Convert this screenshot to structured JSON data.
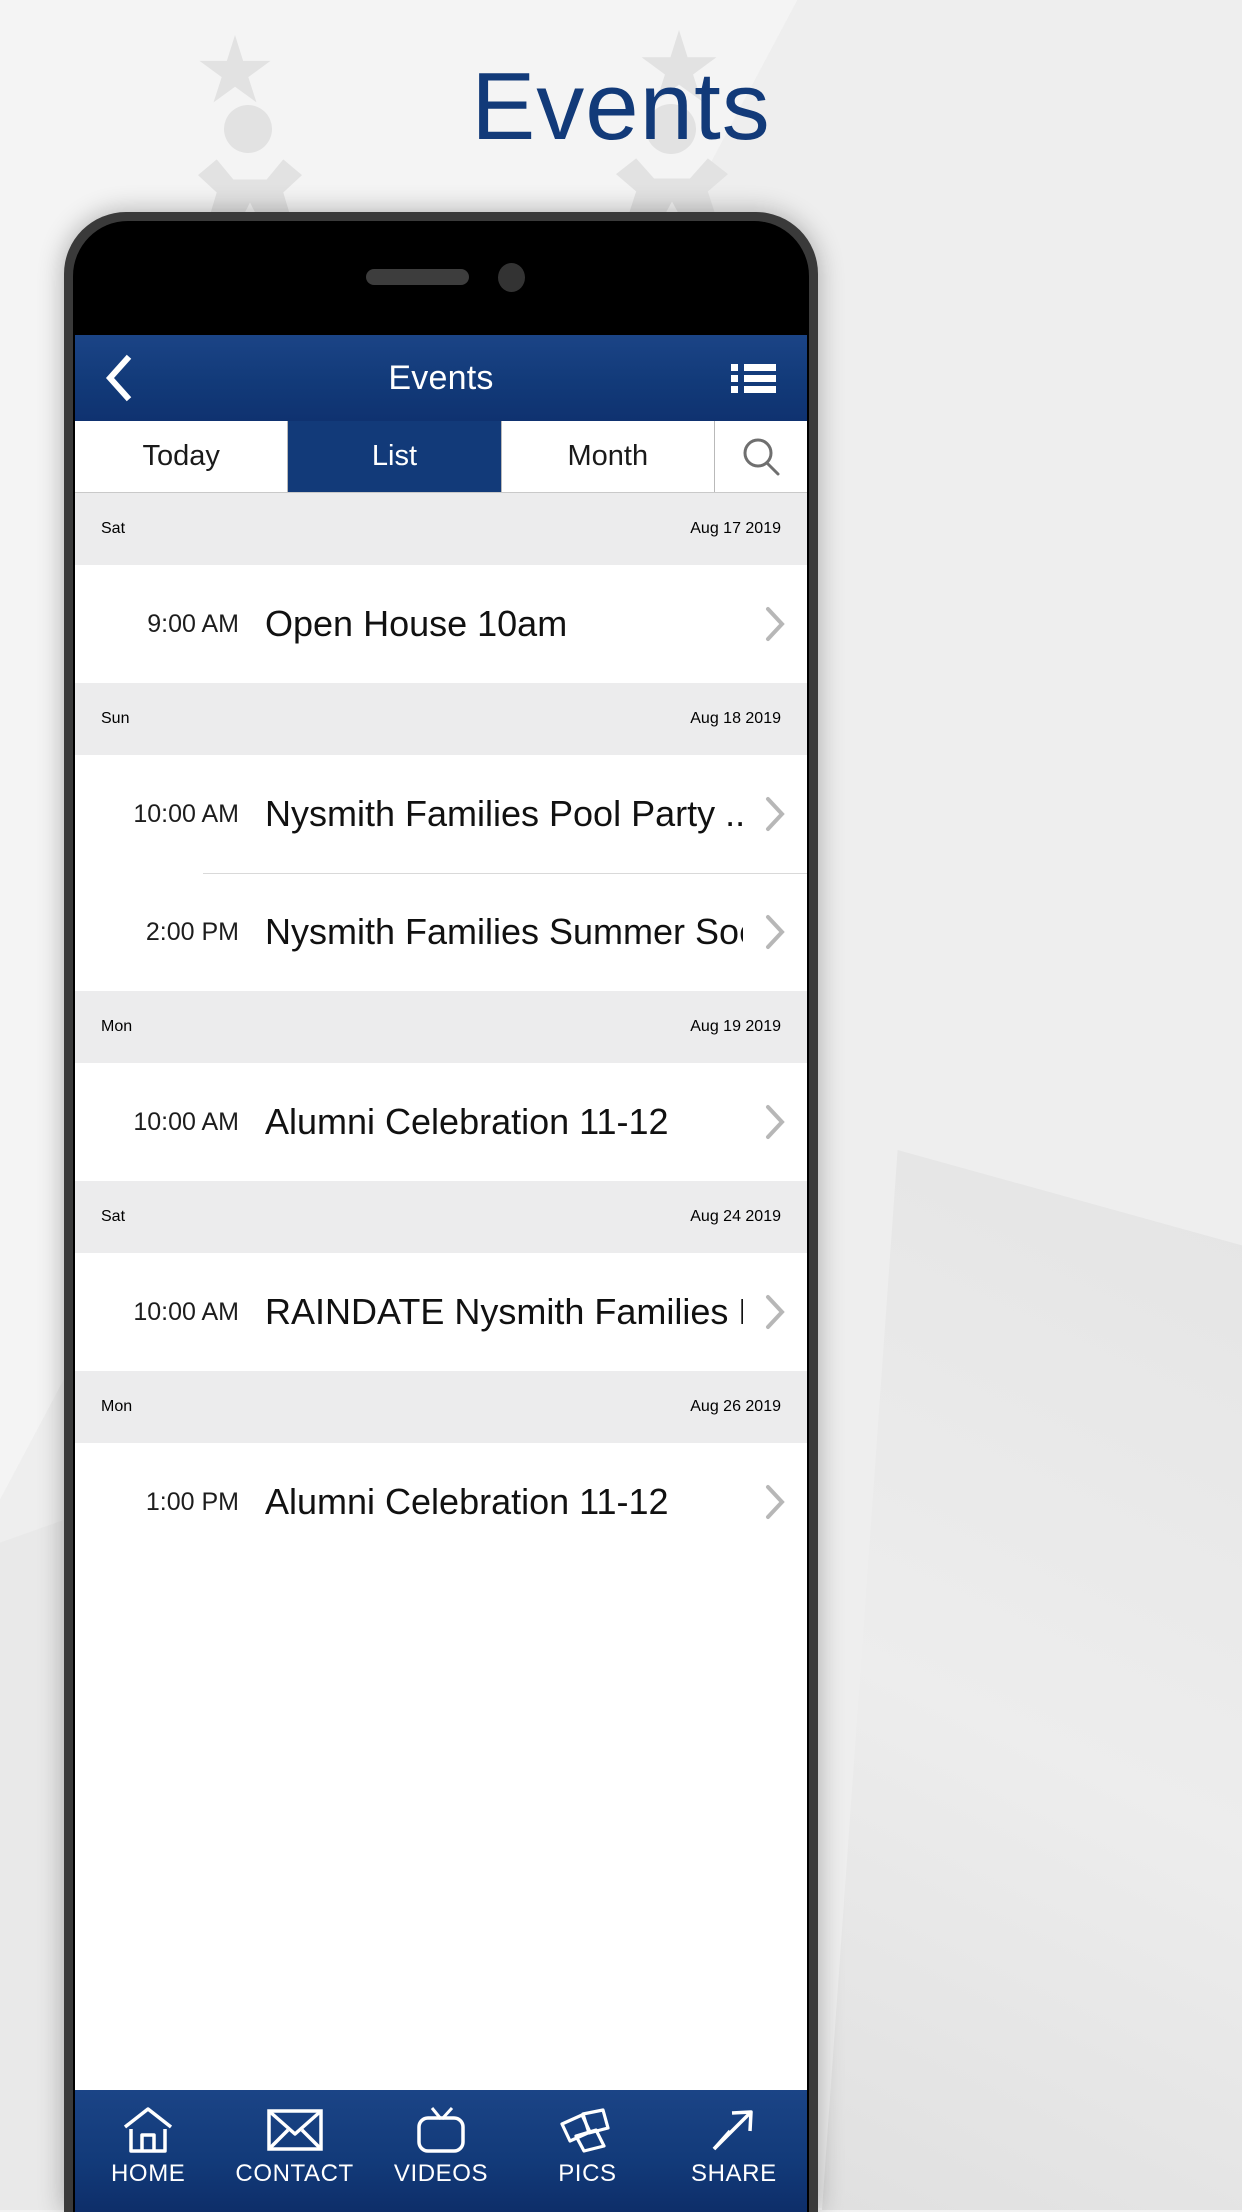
{
  "promo": {
    "title": "Events"
  },
  "phone": {
    "navbar": {
      "back_icon": "chevron-left-icon",
      "title": "Events",
      "menu_icon": "list-menu-icon"
    },
    "tabs": [
      {
        "label": "Today",
        "active": false
      },
      {
        "label": "List",
        "active": true
      },
      {
        "label": "Month",
        "active": false
      }
    ],
    "search_icon": "search-icon",
    "groups": [
      {
        "dow": "Sat",
        "date": "Aug 17 2019",
        "events": [
          {
            "time": "9:00 AM",
            "title": "Open House 10am"
          }
        ]
      },
      {
        "dow": "Sun",
        "date": "Aug 18 2019",
        "events": [
          {
            "time": "10:00 AM",
            "title": "Nysmith Families Pool Party ..."
          },
          {
            "time": "2:00 PM",
            "title": "Nysmith Families Summer Soci..."
          }
        ]
      },
      {
        "dow": "Mon",
        "date": "Aug 19 2019",
        "events": [
          {
            "time": "10:00 AM",
            "title": "Alumni Celebration 11-12"
          }
        ]
      },
      {
        "dow": "Sat",
        "date": "Aug 24 2019",
        "events": [
          {
            "time": "10:00 AM",
            "title": "RAINDATE Nysmith Families Po..."
          }
        ]
      },
      {
        "dow": "Mon",
        "date": "Aug 26 2019",
        "events": [
          {
            "time": "1:00 PM",
            "title": "Alumni Celebration 11-12"
          }
        ]
      }
    ],
    "bottom_nav": [
      {
        "label": "HOME",
        "icon": "home-icon"
      },
      {
        "label": "CONTACT",
        "icon": "envelope-icon"
      },
      {
        "label": "VIDEOS",
        "icon": "tv-icon"
      },
      {
        "label": "PICS",
        "icon": "photos-icon"
      },
      {
        "label": "SHARE",
        "icon": "share-arrow-icon"
      }
    ]
  },
  "colors": {
    "brand_navy": "#123a79",
    "title_navy": "#123a79",
    "group_header_bg": "#ececed",
    "page_bg": "#f2f2f2"
  }
}
